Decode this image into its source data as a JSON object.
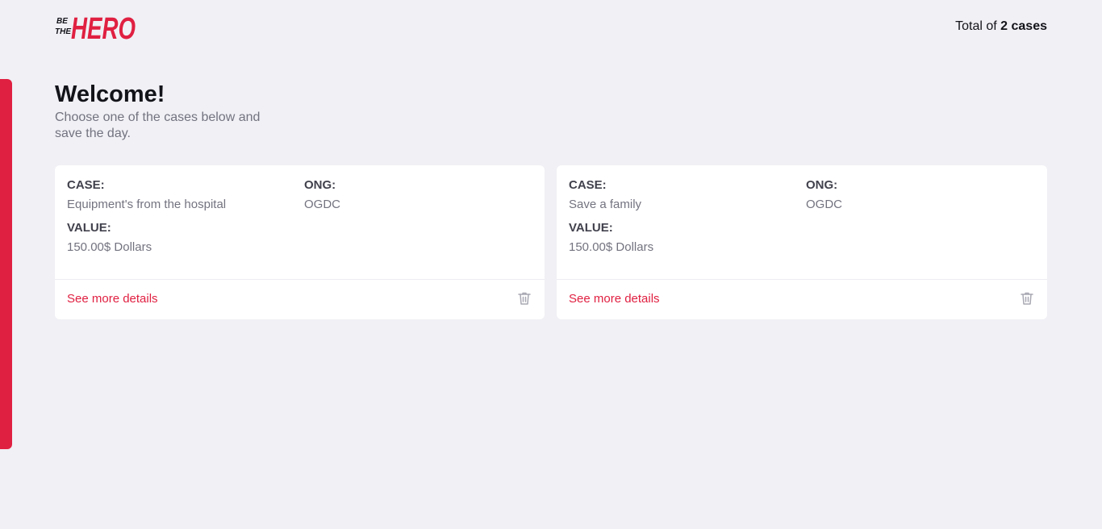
{
  "brand": {
    "logo_line1": "BE",
    "logo_line2": "THE",
    "logo_word": "HERO",
    "accent_color": "#e02041"
  },
  "header": {
    "total_prefix": "Total of",
    "total_count": "2 cases"
  },
  "welcome": {
    "title": "Welcome!",
    "subtitle": "Choose one of the cases below and save the day."
  },
  "cases": [
    {
      "case_label": "CASE:",
      "case_value": "Equipment's from the hospital",
      "ong_label": "ONG:",
      "ong_value": "OGDC",
      "value_label": "VALUE:",
      "value_value": "150.00$ Dollars",
      "details_link": "See more details",
      "delete_icon": "trash-icon"
    },
    {
      "case_label": "CASE:",
      "case_value": "Save a family",
      "ong_label": "ONG:",
      "ong_value": "OGDC",
      "value_label": "VALUE:",
      "value_value": "150.00$ Dollars",
      "details_link": "See more details",
      "delete_icon": "trash-icon"
    }
  ]
}
